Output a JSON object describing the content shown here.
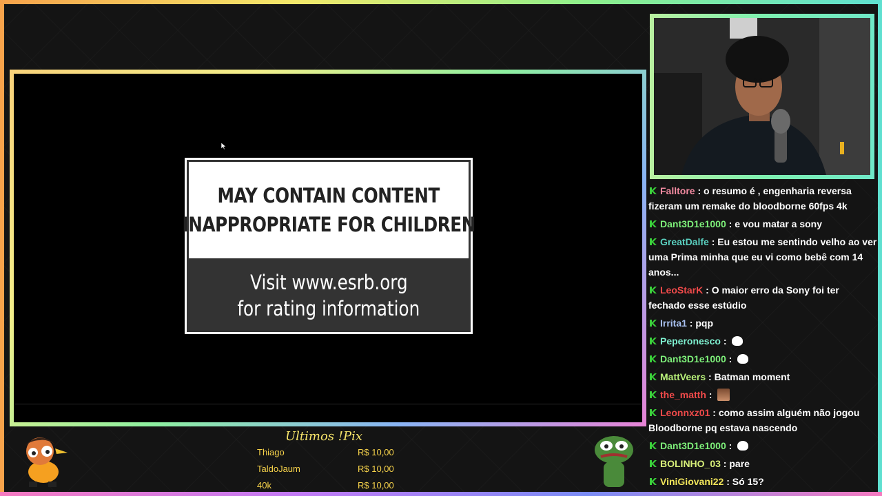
{
  "esrb": {
    "line1": "MAY CONTAIN CONTENT",
    "line2": "INAPPROPRIATE FOR CHILDREN",
    "line3": "Visit www.esrb.org",
    "line4": "for rating information"
  },
  "chat": {
    "messages": [
      {
        "user": "Falltore",
        "color": "#f28aa0",
        "text": "o resumo é , engenharia reversa fizeram um remake do bloodborne 60fps 4k"
      },
      {
        "user": "Dant3D1e1000",
        "color": "#7ef07a",
        "text": "e vou matar a sony"
      },
      {
        "user": "GreatDalfe",
        "color": "#5ad0c0",
        "text": "Eu estou me sentindo velho ao ver uma Prima minha que eu vi como bebê com 14 anos..."
      },
      {
        "user": "LeoStarK",
        "color": "#f04a4a",
        "text": "O maior erro da Sony foi ter fechado esse estúdio"
      },
      {
        "user": "Irrita1",
        "color": "#a8c0f0",
        "text": "pqp"
      },
      {
        "user": "Peperonesco",
        "color": "#7ef0d0",
        "text": "",
        "emote": "speech-bubble-emote"
      },
      {
        "user": "Dant3D1e1000",
        "color": "#7ef07a",
        "text": "",
        "emote": "speech-bubble-emote"
      },
      {
        "user": "MattVeers",
        "color": "#b8f07a",
        "text": "Batman moment"
      },
      {
        "user": "the_matth",
        "color": "#f04a4a",
        "text": "",
        "emote": "face-emote"
      },
      {
        "user": "Leonnxz01",
        "color": "#f04a4a",
        "text": "como assim alguém não jogou Bloodborne pq estava nascendo"
      },
      {
        "user": "Dant3D1e1000",
        "color": "#7ef07a",
        "text": "",
        "emote": "speech-bubble-emote"
      },
      {
        "user": "BOLINHO_03",
        "color": "#d8f07a",
        "text": "pare"
      },
      {
        "user": "ViniGiovani22",
        "color": "#f0e45a",
        "text": "Só 15?"
      }
    ],
    "badge_color": "#3ad03a"
  },
  "pix": {
    "title": "Ultimos !Pix",
    "rows": [
      {
        "name": "Thiago",
        "amount": "R$ 10,00"
      },
      {
        "name": "TaldoJaum",
        "amount": "R$ 10,00"
      },
      {
        "name": "40k",
        "amount": "R$ 10,00"
      }
    ]
  }
}
